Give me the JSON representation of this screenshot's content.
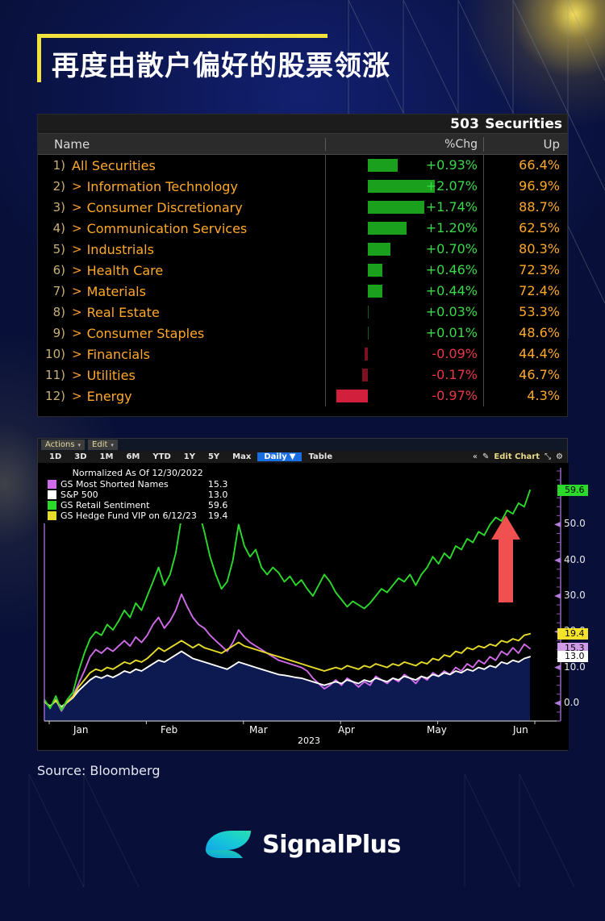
{
  "title": "再度由散户偏好的股票领涨",
  "colors": {
    "accent_yellow": "#f2e23c",
    "bg_navy": "#0a1143",
    "positive_green": "#3ad94a",
    "negative_red": "#e8384a",
    "row_amber": "#ffa929",
    "arrow_red": "#f0504f"
  },
  "table": {
    "count": "503",
    "count_label": "Securities",
    "columns": {
      "name": "Name",
      "chg": "%Chg",
      "up": "Up"
    },
    "rows": [
      {
        "idx": "1)",
        "caret": "",
        "name": "All Securities",
        "chg": "+0.93%",
        "chg_val": 0.93,
        "up": "66.4%"
      },
      {
        "idx": "2)",
        "caret": ">",
        "name": "Information Technology",
        "chg": "+2.07%",
        "chg_val": 2.07,
        "up": "96.9%"
      },
      {
        "idx": "3)",
        "caret": ">",
        "name": "Consumer Discretionary",
        "chg": "+1.74%",
        "chg_val": 1.74,
        "up": "88.7%"
      },
      {
        "idx": "4)",
        "caret": ">",
        "name": "Communication Services",
        "chg": "+1.20%",
        "chg_val": 1.2,
        "up": "62.5%"
      },
      {
        "idx": "5)",
        "caret": ">",
        "name": "Industrials",
        "chg": "+0.70%",
        "chg_val": 0.7,
        "up": "80.3%"
      },
      {
        "idx": "6)",
        "caret": ">",
        "name": "Health Care",
        "chg": "+0.46%",
        "chg_val": 0.46,
        "up": "72.3%"
      },
      {
        "idx": "7)",
        "caret": ">",
        "name": "Materials",
        "chg": "+0.44%",
        "chg_val": 0.44,
        "up": "72.4%"
      },
      {
        "idx": "8)",
        "caret": ">",
        "name": "Real Estate",
        "chg": "+0.03%",
        "chg_val": 0.03,
        "up": "53.3%"
      },
      {
        "idx": "9)",
        "caret": ">",
        "name": "Consumer Staples",
        "chg": "+0.01%",
        "chg_val": 0.01,
        "up": "48.6%"
      },
      {
        "idx": "10)",
        "caret": ">",
        "name": "Financials",
        "chg": "-0.09%",
        "chg_val": -0.09,
        "up": "44.4%"
      },
      {
        "idx": "11)",
        "caret": ">",
        "name": "Utilities",
        "chg": "-0.17%",
        "chg_val": -0.17,
        "up": "46.7%"
      },
      {
        "idx": "12)",
        "caret": ">",
        "name": "Energy",
        "chg": "-0.97%",
        "chg_val": -0.97,
        "up": "4.3%"
      }
    ]
  },
  "chart_toolbar": {
    "menus": [
      "Actions",
      "Edit"
    ],
    "ranges": [
      "1D",
      "3D",
      "1M",
      "6M",
      "YTD",
      "1Y",
      "5Y",
      "Max"
    ],
    "selected_interval": "Daily",
    "table_button": "Table",
    "collapse_icon": "«",
    "pencil_icon": "✎",
    "edit_chart": "Edit Chart",
    "expand_icon": "⤡",
    "gear_icon": "⚙"
  },
  "chart_data": {
    "type": "line",
    "title": "Normalized As Of 12/30/2022",
    "xlabel": "2023",
    "ylabel": "",
    "ylim": [
      -5,
      65
    ],
    "grid": false,
    "legend_position": "top-left",
    "x_ticks": [
      "Jan",
      "Feb",
      "Mar",
      "Apr",
      "May",
      "Jun"
    ],
    "y_ticks": [
      "0.0",
      "10.0",
      "20.0",
      "30.0",
      "40.0",
      "50.0"
    ],
    "axis_tags": [
      {
        "label": "59.6",
        "color": "#2bd92b",
        "text_color": "#000000",
        "value": 59.6
      },
      {
        "label": "19.4",
        "color": "#f5e32b",
        "text_color": "#000000",
        "value": 19.4
      },
      {
        "label": "15.3",
        "color": "#cf9ae8",
        "text_color": "#000000",
        "value": 15.3
      },
      {
        "label": "13.0",
        "color": "#ffffff",
        "text_color": "#000000",
        "value": 13.0
      }
    ],
    "series": [
      {
        "name": "GS Most Shorted Names",
        "color": "#cf6ae8",
        "last_value": "15.3",
        "values": [
          0.5,
          -1.2,
          1.0,
          -2.2,
          0.4,
          2.0,
          5.5,
          9.0,
          13.0,
          15.0,
          14.0,
          15.5,
          14.5,
          16.0,
          17.5,
          16.0,
          18.5,
          17.0,
          19.0,
          22.0,
          24.0,
          21.0,
          23.0,
          26.0,
          30.5,
          27.0,
          24.0,
          22.0,
          21.0,
          19.0,
          17.5,
          16.0,
          14.5,
          17.0,
          20.5,
          18.5,
          17.0,
          16.0,
          15.0,
          14.0,
          13.0,
          12.0,
          11.5,
          11.0,
          10.5,
          10.0,
          9.0,
          7.0,
          5.5,
          4.0,
          5.0,
          6.5,
          5.0,
          7.0,
          6.0,
          4.5,
          6.0,
          5.0,
          7.5,
          6.5,
          5.5,
          7.0,
          6.0,
          8.0,
          7.0,
          5.5,
          7.5,
          6.5,
          8.5,
          7.5,
          9.0,
          8.0,
          10.0,
          9.0,
          11.0,
          10.0,
          12.0,
          11.0,
          13.0,
          12.0,
          14.5,
          13.5,
          15.5,
          14.0,
          16.5,
          15.3
        ]
      },
      {
        "name": "S&P 500",
        "color": "#ffffff",
        "last_value": "13.0",
        "values": [
          0.3,
          -0.8,
          0.6,
          -1.0,
          0.2,
          1.5,
          3.5,
          5.0,
          6.5,
          7.5,
          7.0,
          7.8,
          7.2,
          8.0,
          9.0,
          8.5,
          9.5,
          9.0,
          10.0,
          11.0,
          12.0,
          11.5,
          12.5,
          13.5,
          14.5,
          13.5,
          12.5,
          12.0,
          11.5,
          11.0,
          10.5,
          10.0,
          9.5,
          10.5,
          11.5,
          11.0,
          10.5,
          10.0,
          9.5,
          9.0,
          8.5,
          8.0,
          7.8,
          7.5,
          7.2,
          7.0,
          6.5,
          6.0,
          5.5,
          5.0,
          5.5,
          6.0,
          5.5,
          6.5,
          6.0,
          5.5,
          6.5,
          6.0,
          7.0,
          6.5,
          6.0,
          7.0,
          6.5,
          7.5,
          7.0,
          6.5,
          7.5,
          7.0,
          8.0,
          7.5,
          8.5,
          8.0,
          9.0,
          8.5,
          9.5,
          9.0,
          10.0,
          9.5,
          10.5,
          10.0,
          11.5,
          11.0,
          12.0,
          11.5,
          12.5,
          13.0
        ]
      },
      {
        "name": "GS Retail Sentiment",
        "color": "#2bd92b",
        "last_value": "59.6",
        "values": [
          1.0,
          -1.5,
          2.0,
          -2.0,
          1.0,
          3.0,
          9.0,
          14.0,
          18.0,
          20.0,
          19.0,
          22.0,
          20.5,
          23.0,
          26.0,
          24.0,
          28.0,
          26.0,
          30.0,
          34.0,
          38.0,
          33.0,
          36.0,
          42.0,
          52.0,
          55.0,
          51.0,
          54.0,
          48.0,
          41.0,
          36.0,
          32.0,
          34.0,
          40.0,
          50.0,
          44.0,
          41.0,
          43.0,
          38.0,
          36.0,
          38.0,
          36.5,
          34.0,
          35.5,
          33.0,
          34.5,
          32.0,
          30.0,
          33.0,
          36.0,
          34.0,
          31.0,
          29.0,
          27.0,
          28.5,
          27.5,
          26.5,
          28.0,
          30.0,
          32.0,
          31.0,
          33.0,
          35.0,
          34.0,
          36.0,
          33.0,
          36.0,
          38.0,
          41.0,
          39.0,
          42.0,
          40.5,
          44.0,
          43.0,
          46.0,
          45.0,
          48.0,
          47.0,
          50.0,
          52.0,
          51.0,
          54.0,
          53.0,
          56.0,
          55.0,
          59.6
        ]
      },
      {
        "name": "GS Hedge Fund VIP on 6/12/23",
        "color": "#e8dc2b",
        "last_value": "19.4",
        "values": [
          0.4,
          -1.0,
          0.8,
          -1.5,
          0.3,
          1.8,
          4.5,
          6.5,
          8.5,
          9.5,
          9.0,
          10.0,
          9.5,
          10.5,
          11.5,
          11.0,
          12.0,
          11.5,
          12.5,
          14.0,
          15.5,
          14.5,
          15.5,
          16.5,
          17.5,
          16.5,
          15.5,
          16.5,
          15.5,
          15.0,
          14.5,
          14.0,
          15.0,
          16.0,
          17.0,
          16.0,
          15.5,
          15.0,
          14.5,
          14.0,
          13.5,
          13.0,
          12.5,
          12.0,
          11.5,
          11.0,
          10.5,
          10.0,
          9.5,
          9.0,
          9.5,
          10.0,
          9.5,
          10.5,
          10.0,
          9.5,
          10.5,
          10.0,
          11.0,
          10.5,
          10.0,
          11.0,
          10.5,
          11.5,
          11.0,
          10.5,
          11.5,
          11.0,
          12.5,
          12.0,
          13.5,
          13.0,
          14.5,
          14.0,
          15.5,
          15.0,
          16.0,
          15.5,
          16.5,
          16.0,
          17.5,
          17.0,
          18.0,
          17.5,
          19.0,
          19.4
        ]
      }
    ],
    "annotation": {
      "type": "up-arrow",
      "color": "#f0504f"
    }
  },
  "source": "Source: Bloomberg",
  "brand": {
    "name": "SignalPlus"
  }
}
